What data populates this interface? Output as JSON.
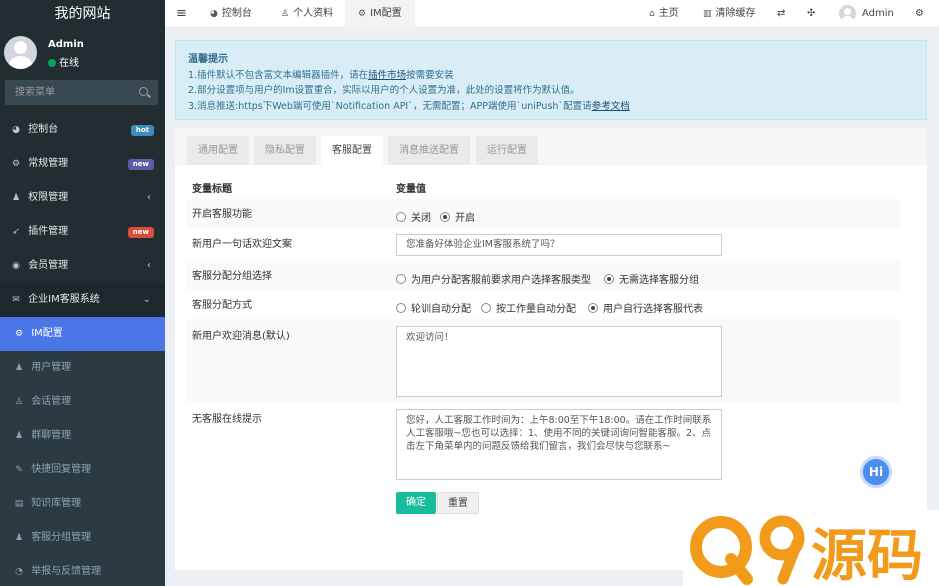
{
  "sidebar": {
    "site_title": "我的网站",
    "user_name": "Admin",
    "user_status": "在线",
    "search_placeholder": "搜索菜单",
    "items": [
      {
        "label": "控制台",
        "icon": "dashboard-icon",
        "badge": "hot",
        "badge_color": "#3c8dbc"
      },
      {
        "label": "常规管理",
        "icon": "cogs-icon",
        "badge": "new",
        "badge_color": "#605ca8"
      },
      {
        "label": "权限管理",
        "icon": "group-icon"
      },
      {
        "label": "插件管理",
        "icon": "rocket-icon",
        "badge": "new",
        "badge_color": "#dd4b39"
      },
      {
        "label": "会员管理",
        "icon": "user-circle-icon"
      },
      {
        "label": "企业IM客服系统",
        "icon": "comments-icon"
      },
      {
        "label": "IM配置",
        "icon": "cogs-icon"
      },
      {
        "label": "用户管理",
        "icon": "users-icon"
      },
      {
        "label": "会话管理",
        "icon": "user-icon"
      },
      {
        "label": "群聊管理",
        "icon": "users-icon"
      },
      {
        "label": "快捷回复管理",
        "icon": "pencil-icon"
      },
      {
        "label": "知识库管理",
        "icon": "book-icon"
      },
      {
        "label": "客服分组管理",
        "icon": "users-icon"
      },
      {
        "label": "举报与反馈管理",
        "icon": "rss-icon"
      }
    ]
  },
  "navbar": {
    "tabs": [
      "控制台",
      "个人资料",
      "IM配置"
    ],
    "home": "主页",
    "clear_cache": "清除缓存",
    "admin": "Admin"
  },
  "callout": {
    "title": "温馨提示",
    "line1_a": "1.插件默认不包含富文本编辑器插件，请在",
    "line1_link": "插件市场",
    "line1_b": "按需要安装",
    "line2": "2.部分设置项与用户的Im设置重合，实际以用户的个人设置为准，此处的设置将作为默认值。",
    "line3_a": "3.消息推送:https下Web端可使用`Notification API`，无需配置；APP端使用`uniPush`配置请",
    "line3_link": "参考文档"
  },
  "config_tabs": [
    "通用配置",
    "隐私配置",
    "客服配置",
    "消息推送配置",
    "运行配置"
  ],
  "table": {
    "col_title": "变量标题",
    "col_value": "变量值"
  },
  "form": {
    "enable_cs": {
      "label": "开启客服功能",
      "options": [
        "关闭",
        "开启"
      ],
      "selected": "开启"
    },
    "welcome_text": {
      "label": "新用户一句话欢迎文案",
      "value": "您准备好体验企业IM客服系统了吗？"
    },
    "group_select": {
      "label": "客服分配分组选择",
      "options": [
        "为用户分配客服前要求用户选择客服类型",
        "无需选择客服分组"
      ],
      "selected": "无需选择客服分组"
    },
    "assign_mode": {
      "label": "客服分配方式",
      "options": [
        "轮训自动分配",
        "按工作量自动分配",
        "用户自行选择客服代表"
      ],
      "selected": "用户自行选择客服代表"
    },
    "welcome_msg": {
      "label": "新用户欢迎消息(默认)",
      "value": "欢迎访问！"
    },
    "offline_tip": {
      "label": "无客服在线提示",
      "value": "您好，人工客服工作时间为：上午8:00至下午18:00。请在工作时间联系人工客服哦~您也可以选择：1、使用不同的关键词询问智能客服。2、点击左下角菜单内的问题反馈给我们留言，我们会尽快与您联系~"
    }
  },
  "buttons": {
    "ok": "确定",
    "reset": "重置"
  },
  "chat_bubble": "Hi",
  "watermark": "Q9源码",
  "colors": {
    "sidebar_bg": "#222d32",
    "active_menu": "#4a76e8",
    "primary_btn": "#18bc9c",
    "callout_bg": "#d9edf7",
    "watermark": "#f29b1b"
  }
}
